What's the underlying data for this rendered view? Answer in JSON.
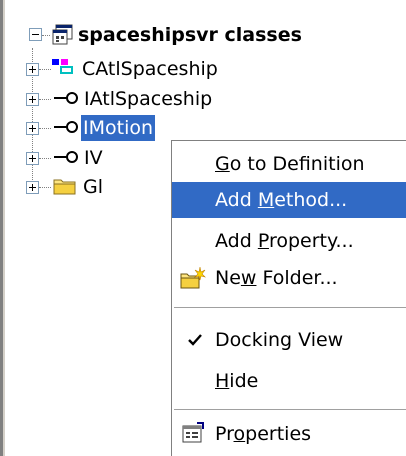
{
  "tree": {
    "root": {
      "label": "spaceshipsvr classes",
      "icon": "class-view-root-icon"
    },
    "items": [
      {
        "label": "CAtlSpaceship",
        "icon": "class-icon"
      },
      {
        "label": "IAtlSpaceship",
        "icon": "interface-icon"
      },
      {
        "label": "IMotion",
        "icon": "interface-icon",
        "selected": true
      },
      {
        "label": "IV",
        "icon": "interface-icon"
      },
      {
        "label": "Gl",
        "icon": "folder-icon"
      }
    ]
  },
  "context_menu": {
    "items": [
      {
        "pre": "",
        "u": "G",
        "post": "o to Definition"
      },
      {
        "pre": "Add ",
        "u": "M",
        "post": "ethod..."
      },
      {
        "pre": "Add ",
        "u": "P",
        "post": "roperty..."
      },
      {
        "pre": "Ne",
        "u": "w",
        "post": " Folder..."
      },
      {
        "pre": "Docking View",
        "u": "",
        "post": ""
      },
      {
        "pre": "",
        "u": "H",
        "post": "ide"
      },
      {
        "pre": "Pr",
        "u": "o",
        "post": "perties"
      }
    ]
  },
  "colors": {
    "selection": "#316ac5",
    "menu_bg": "#ffffff",
    "frame": "#d4d0c8"
  }
}
